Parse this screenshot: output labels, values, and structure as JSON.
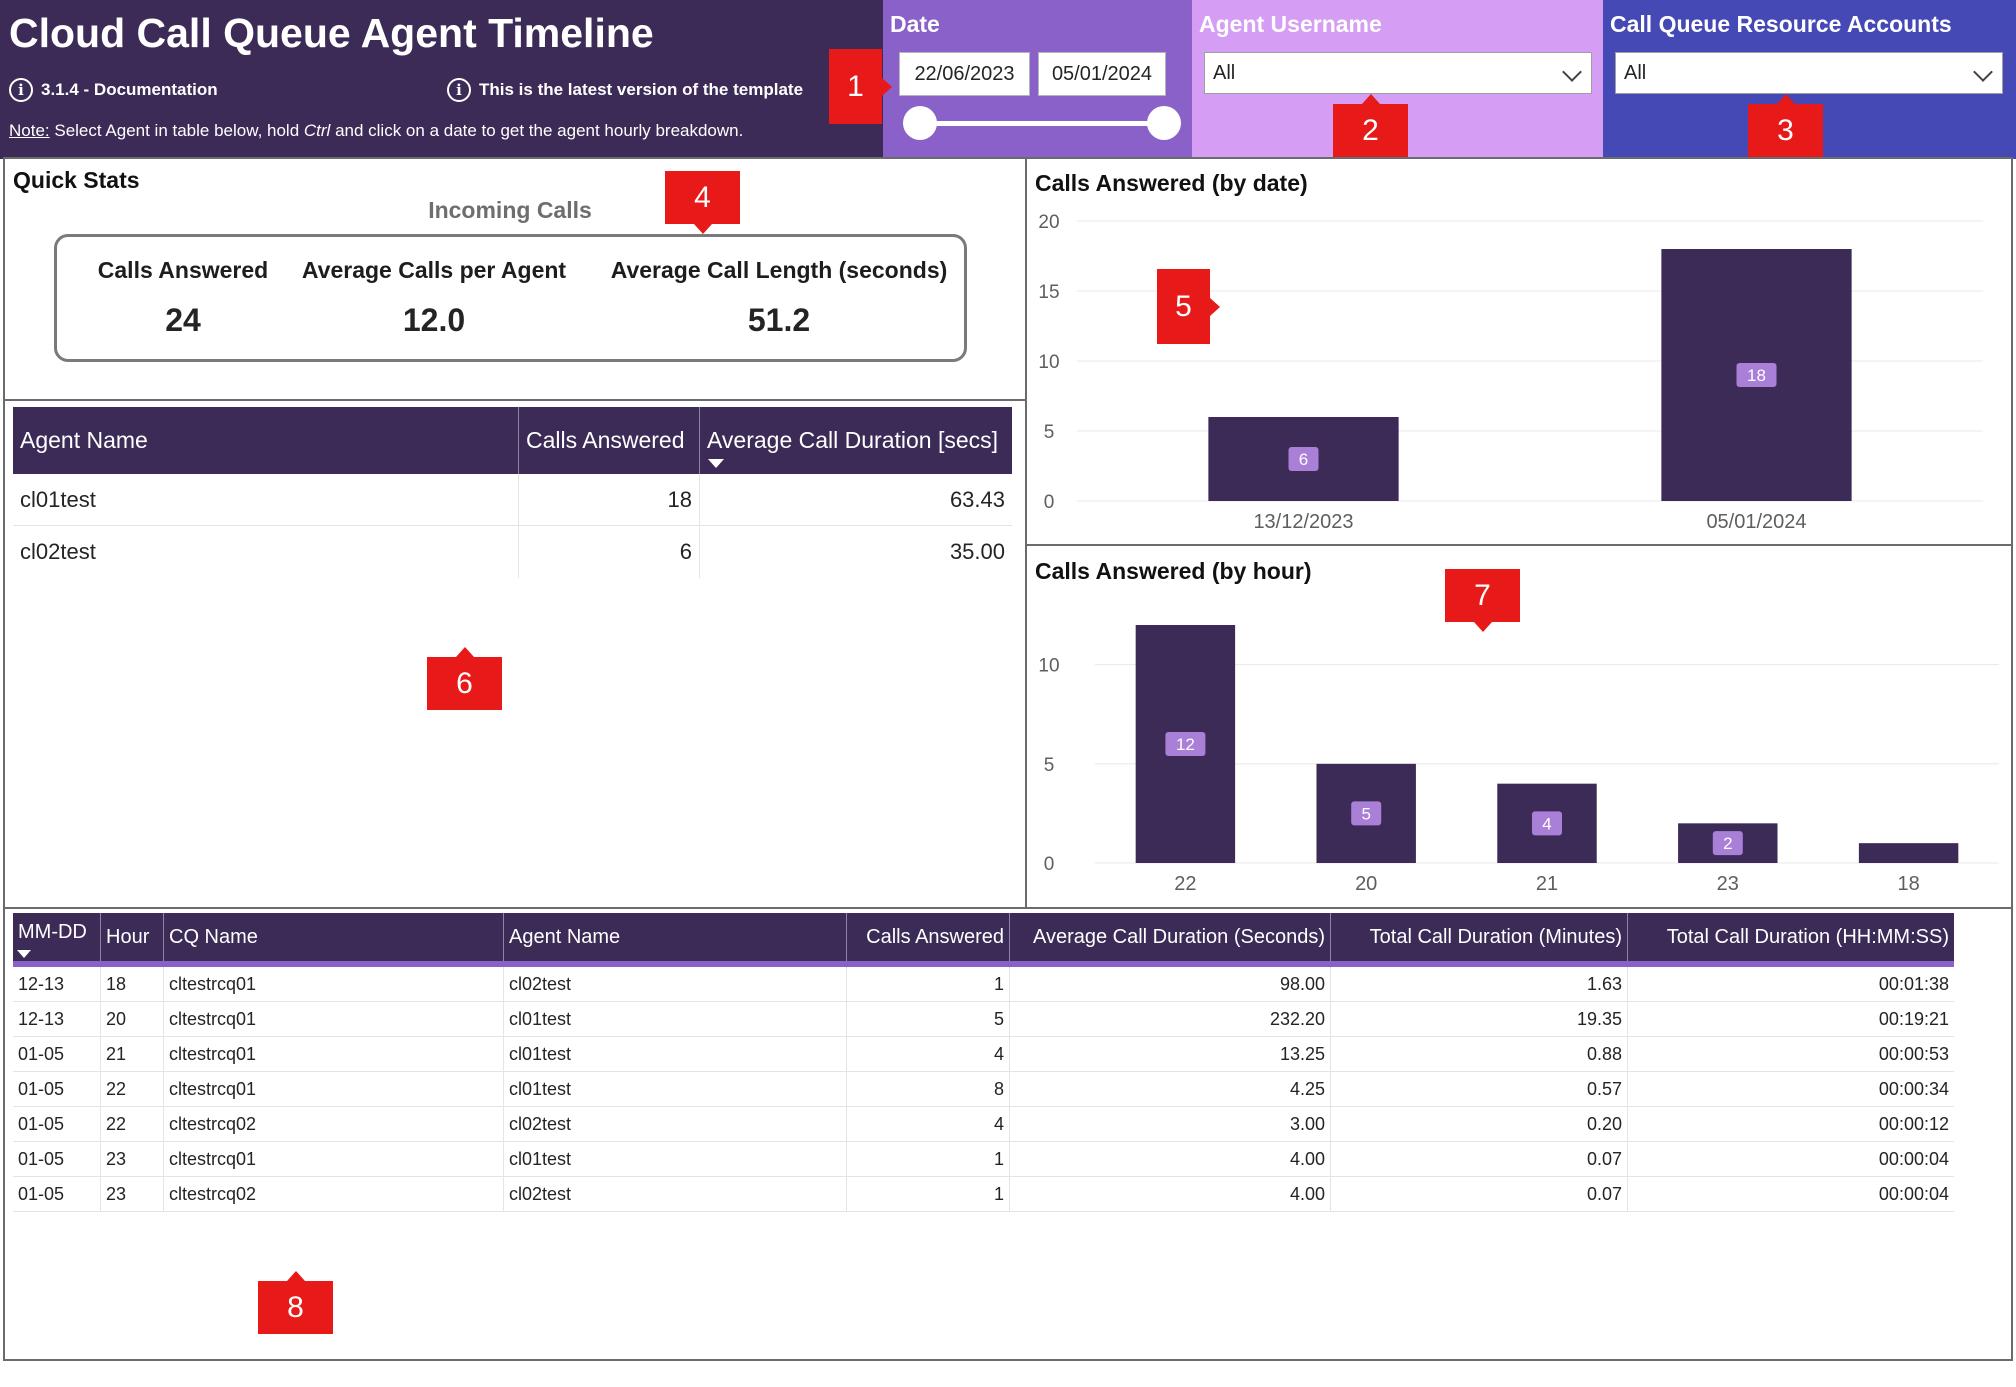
{
  "header": {
    "title": "Cloud Call Queue Agent Timeline",
    "doc_link": "3.1.4 - Documentation",
    "version_note": "This is the latest version of the template",
    "note_label": "Note:",
    "note_pre": " Select Agent in table below, hold ",
    "note_key": "Ctrl",
    "note_post": " and click on a date to get the agent hourly breakdown.",
    "info_icon": "info-icon"
  },
  "filters": {
    "date": {
      "label": "Date",
      "start": "22/06/2023",
      "end": "05/01/2024"
    },
    "agent": {
      "label": "Agent Username",
      "value": "All"
    },
    "cq": {
      "label": "Call Queue Resource Accounts",
      "value": "All"
    }
  },
  "badges": [
    "1",
    "2",
    "3",
    "4",
    "5",
    "6",
    "7",
    "8"
  ],
  "colors": {
    "header_bg": "#3c2b56",
    "date_panel": "#8a61c8",
    "agent_panel": "#d59df4",
    "cq_panel": "#4549b5",
    "bar": "#3c2b56",
    "data_label": "#a97fd8",
    "badge": "#e81919"
  },
  "quick_stats": {
    "title": "Quick Stats",
    "subtitle": "Incoming Calls",
    "kpis": [
      {
        "label": "Calls Answered",
        "value": "24"
      },
      {
        "label": "Average Calls per Agent",
        "value": "12.0"
      },
      {
        "label": "Average Call Length (seconds)",
        "value": "51.2"
      }
    ]
  },
  "agent_table": {
    "columns": [
      "Agent Name",
      "Calls Answered",
      "Average Call Duration [secs]"
    ],
    "rows": [
      [
        "cl01test",
        "18",
        "63.43"
      ],
      [
        "cl02test",
        "6",
        "35.00"
      ]
    ]
  },
  "chart_data": [
    {
      "type": "bar",
      "title": "Calls Answered (by date)",
      "categories": [
        "13/12/2023",
        "05/01/2024"
      ],
      "values": [
        6,
        18
      ],
      "ylim": [
        0,
        20
      ],
      "yticks": [
        0,
        5,
        10,
        15,
        20
      ],
      "grid": true,
      "data_labels": true
    },
    {
      "type": "bar",
      "title": "Calls Answered (by hour)",
      "categories": [
        "22",
        "20",
        "21",
        "23",
        "18"
      ],
      "values": [
        12,
        5,
        4,
        2,
        1
      ],
      "value_labels": [
        "12",
        "5",
        "4",
        "2",
        ""
      ],
      "ylim": [
        0,
        12
      ],
      "yticks": [
        0,
        5,
        10
      ],
      "grid": true,
      "data_labels": true
    }
  ],
  "detail_table": {
    "columns": [
      "MM-DD",
      "Hour",
      "CQ Name",
      "Agent Name",
      "Calls Answered",
      "Average Call Duration (Seconds)",
      "Total Call Duration (Minutes)",
      "Total Call Duration (HH:MM:SS)"
    ],
    "rows": [
      [
        "12-13",
        "18",
        "cltestrcq01",
        "cl02test",
        "1",
        "98.00",
        "1.63",
        "00:01:38"
      ],
      [
        "12-13",
        "20",
        "cltestrcq01",
        "cl01test",
        "5",
        "232.20",
        "19.35",
        "00:19:21"
      ],
      [
        "01-05",
        "21",
        "cltestrcq01",
        "cl01test",
        "4",
        "13.25",
        "0.88",
        "00:00:53"
      ],
      [
        "01-05",
        "22",
        "cltestrcq01",
        "cl01test",
        "8",
        "4.25",
        "0.57",
        "00:00:34"
      ],
      [
        "01-05",
        "22",
        "cltestrcq02",
        "cl02test",
        "4",
        "3.00",
        "0.20",
        "00:00:12"
      ],
      [
        "01-05",
        "23",
        "cltestrcq01",
        "cl01test",
        "1",
        "4.00",
        "0.07",
        "00:00:04"
      ],
      [
        "01-05",
        "23",
        "cltestrcq02",
        "cl02test",
        "1",
        "4.00",
        "0.07",
        "00:00:04"
      ]
    ]
  }
}
